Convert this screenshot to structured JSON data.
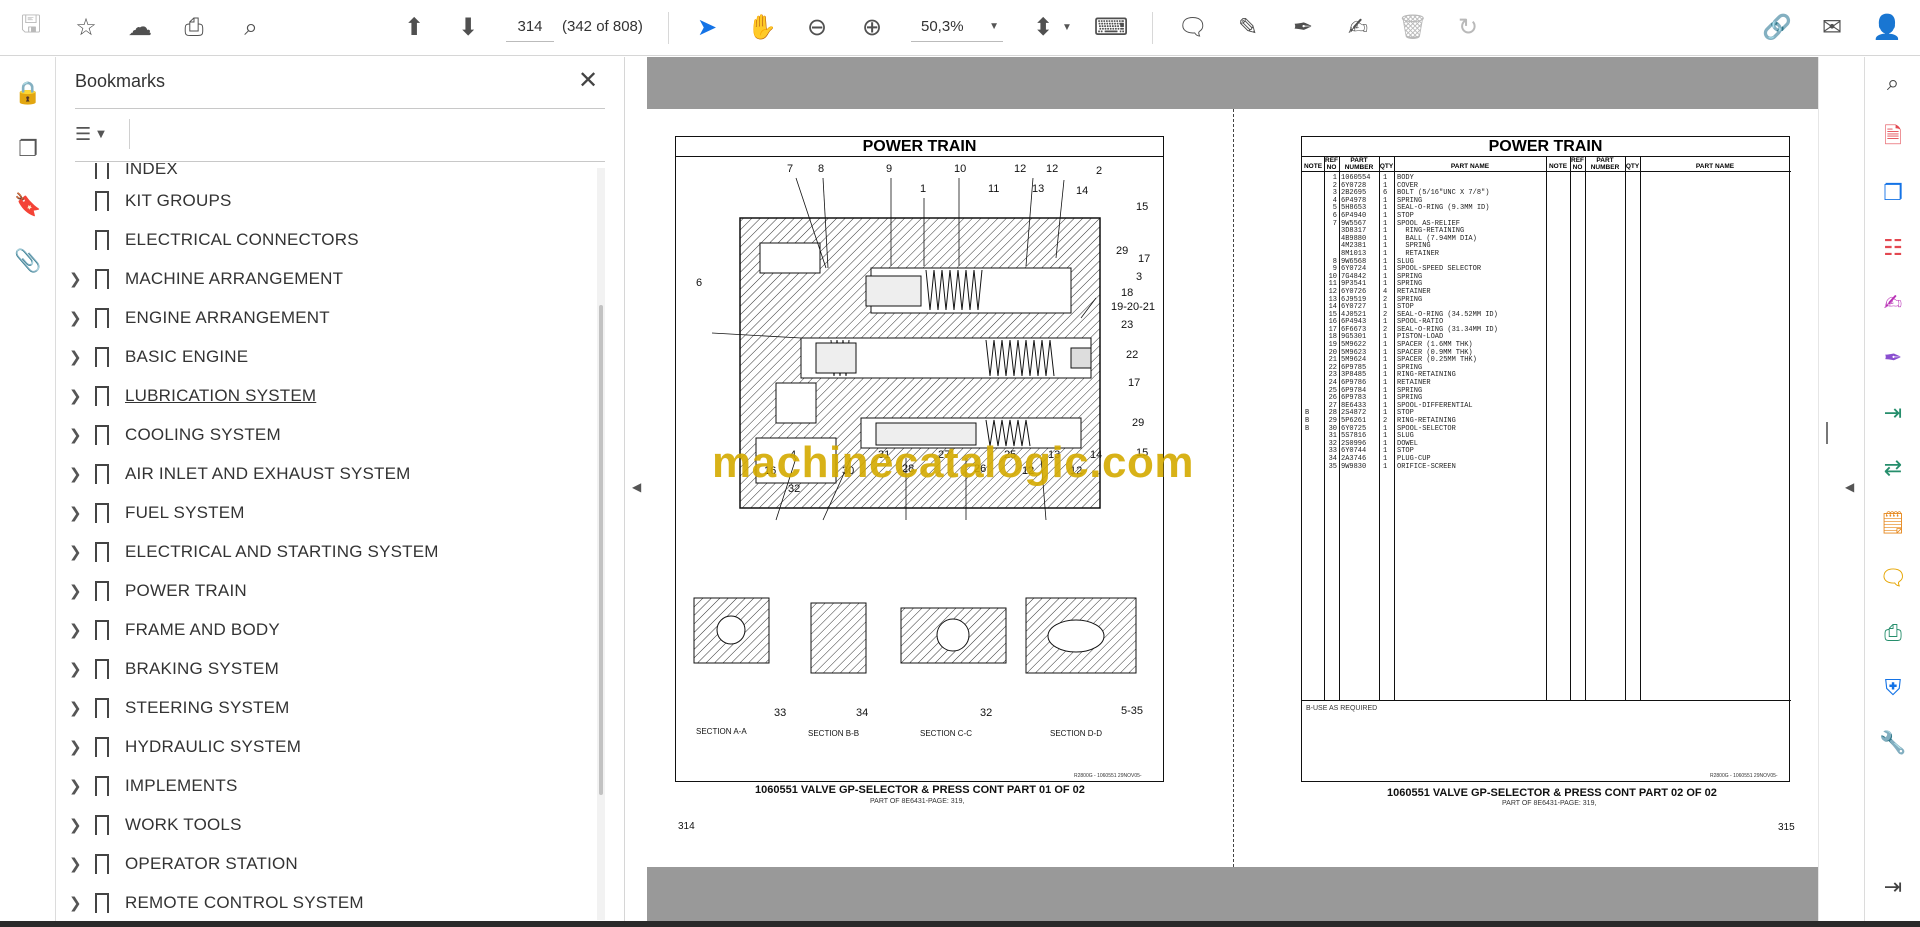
{
  "toolbar": {
    "page_number": "314",
    "page_count": "(342 of 808)",
    "zoom": "50,3%"
  },
  "bookmarks": {
    "title": "Bookmarks",
    "items": [
      {
        "label": "INDEX",
        "expandable": false
      },
      {
        "label": "KIT GROUPS",
        "expandable": false
      },
      {
        "label": "ELECTRICAL CONNECTORS",
        "expandable": false
      },
      {
        "label": "MACHINE ARRANGEMENT",
        "expandable": true
      },
      {
        "label": "ENGINE ARRANGEMENT",
        "expandable": true
      },
      {
        "label": "BASIC ENGINE",
        "expandable": true
      },
      {
        "label": "LUBRICATION SYSTEM",
        "expandable": true
      },
      {
        "label": "COOLING SYSTEM",
        "expandable": true
      },
      {
        "label": "AIR INLET AND EXHAUST SYSTEM",
        "expandable": true
      },
      {
        "label": "FUEL SYSTEM",
        "expandable": true
      },
      {
        "label": "ELECTRICAL AND STARTING SYSTEM",
        "expandable": true
      },
      {
        "label": "POWER TRAIN",
        "expandable": true
      },
      {
        "label": "FRAME AND BODY",
        "expandable": true
      },
      {
        "label": "BRAKING SYSTEM",
        "expandable": true
      },
      {
        "label": "STEERING SYSTEM",
        "expandable": true
      },
      {
        "label": "HYDRAULIC SYSTEM",
        "expandable": true
      },
      {
        "label": "IMPLEMENTS",
        "expandable": true
      },
      {
        "label": "WORK TOOLS",
        "expandable": true
      },
      {
        "label": "OPERATOR STATION",
        "expandable": true
      },
      {
        "label": "REMOTE CONTROL SYSTEM",
        "expandable": true
      }
    ]
  },
  "document": {
    "watermark": "machinecatalogic.com",
    "left_page": {
      "title": "POWER TRAIN",
      "caption": "1060551 VALVE GP-SELECTOR & PRESS CONT   PART 01 OF 02",
      "subcaption": "PART OF 8E6431-PAGE: 319,",
      "page_number": "314",
      "figure_code": "R2800G - 1060551 29NOV05-",
      "sections": [
        "SECTION A-A",
        "SECTION B-B",
        "SECTION C-C",
        "SECTION D-D"
      ],
      "callouts": [
        "7",
        "8",
        "9",
        "1",
        "10",
        "12",
        "12",
        "2",
        "11",
        "13",
        "14",
        "15",
        "29",
        "17",
        "3",
        "6",
        "18",
        "19-20-21",
        "23",
        "22",
        "17",
        "29",
        "15",
        "16",
        "4",
        "30",
        "28",
        "31",
        "27",
        "26",
        "25",
        "12",
        "13",
        "12",
        "14",
        "32",
        "33",
        "34",
        "32",
        "5-35"
      ]
    },
    "right_page": {
      "title": "POWER TRAIN",
      "headers": [
        "NOTE",
        "REF NO",
        "PART NUMBER",
        "QTY",
        "PART NAME",
        "NOTE",
        "REF NO",
        "PART NUMBER",
        "QTY",
        "PART NAME"
      ],
      "note_column": "\n\n\n\n\n\n\n\n\n\n\n\n\n\n\n\n\n\n\n\n\n\n\n\n\n\n\n\n\n\n\nB\nB\nB",
      "ref_column": "1\n2\n3\n4\n5\n6\n7\n\n\n\n\n8\n9\n10\n11\n12\n13\n14\n15\n16\n17\n18\n19\n20\n21\n22\n23\n24\n25\n26\n27\n28\n29\n30\n31\n32\n33\n34\n35",
      "part_numbers": "1060554\n6Y0728\n2B2695\n6P4978\n5H8653\n6P4940\n9W5567\n3D8317\n4B9880\n4M2381\n8M1013\n9W6568\n6Y0724\n7G4842\n9P3541\n6Y0726\n6J9519\n6Y0727\n4J0521\n6P4943\n6F6673\n9G5301\n5M9622\n5M9623\n5M9624\n6P9785\n3P8485\n6P9786\n6P9784\n6P9783\n8E6433\n2S4872\n5P6261\n6Y0725\n5S7816\n2S0996\n6Y0744\n2A3746\n9W9830",
      "qty_column": "1\n1\n6\n1\n1\n1\n1\n1\n1\n1\n1\n1\n1\n1\n1\n4\n2\n1\n2\n1\n2\n1\n1\n1\n1\n1\n1\n1\n1\n1\n1\n1\n2\n1\n1\n1\n1\n1\n1",
      "part_names": "BODY\nCOVER\nBOLT (5/16\"UNC X 7/8\")\nSPRING\nSEAL-O-RING (9.3MM ID)\nSTOP\nSPOOL AS-RELIEF\n  RING-RETAINING\n  BALL (7.94MM DIA)\n  SPRING\n  RETAINER\nSLUG\nSPOOL-SPEED SELECTOR\nSPRING\nSPRING\nRETAINER\nSPRING\nSTOP\nSEAL-O-RING (34.52MM ID)\nSPOOL-RATIO\nSEAL-O-RING (31.34MM ID)\nPISTON-LOAD\nSPACER (1.6MM THK)\nSPACER (0.9MM THK)\nSPACER (0.25MM THK)\nSPRING\nRING-RETAINING\nRETAINER\nSPRING\nSPRING\nSPOOL-DIFFERENTIAL\nSTOP\nRING-RETAINING\nSPOOL-SELECTOR\nSLUG\nDOWEL\nSTOP\nPLUG-CUP\nORIFICE-SCREEN",
      "note_text": "B-USE AS REQUIRED",
      "caption": "1060551 VALVE GP-SELECTOR & PRESS CONT   PART 02 OF 02",
      "subcaption": "PART OF 8E6431-PAGE: 319,",
      "figure_code": "R2800G - 1060551 29NOV05-",
      "page_number": "315"
    }
  }
}
